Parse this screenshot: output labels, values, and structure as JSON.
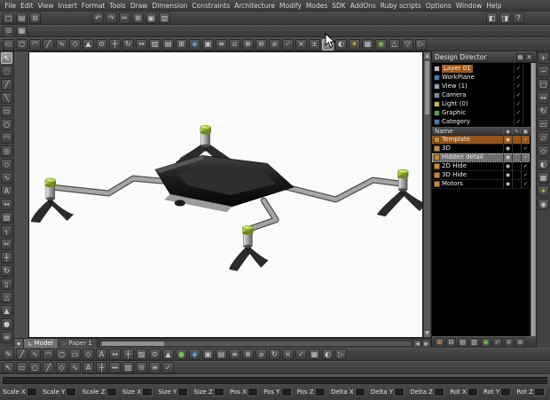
{
  "menu_bar": {
    "items": [
      "File",
      "Edit",
      "View",
      "Insert",
      "Format",
      "Tools",
      "Draw",
      "Dimension",
      "Constraints",
      "Architecture",
      "Modify",
      "Modes",
      "SDK",
      "AddOns",
      "Ruby scripts",
      "Options",
      "Window",
      "Help"
    ]
  },
  "toolbar_row1": {
    "left_icons": [
      {
        "name": "new-file-icon",
        "glyph": "□"
      },
      {
        "name": "open-file-icon",
        "glyph": "▤"
      },
      {
        "name": "save-file-icon",
        "glyph": "⊟"
      }
    ],
    "mid_icons": [
      {
        "name": "undo-icon",
        "glyph": "↶"
      },
      {
        "name": "redo-icon",
        "glyph": "↷"
      },
      {
        "name": "cut-icon",
        "glyph": "✂"
      },
      {
        "name": "copy-icon",
        "glyph": "⊞"
      },
      {
        "name": "paste-icon",
        "glyph": "▣"
      },
      {
        "name": "print-icon",
        "glyph": "▥"
      }
    ],
    "right_icons": [
      {
        "name": "screen-split-icon",
        "glyph": "◧"
      },
      {
        "name": "layout-mode-icon",
        "glyph": "◨"
      },
      {
        "name": "help-icon",
        "glyph": "?"
      }
    ]
  },
  "toolbar_row2": {
    "icons": [
      {
        "name": "snap-toggle-icon",
        "glyph": "⊙"
      },
      {
        "name": "grid-toggle-icon",
        "glyph": "▦"
      }
    ]
  },
  "toolbar_row3": {
    "icons": [
      {
        "name": "rectangle-tool-icon",
        "glyph": "▭"
      },
      {
        "name": "circle-tool-icon",
        "glyph": "○"
      },
      {
        "name": "arc-tool-icon",
        "glyph": "◠"
      },
      {
        "name": "line-tool-icon",
        "glyph": "╱"
      },
      {
        "name": "spline-tool-icon",
        "glyph": "∿"
      },
      {
        "name": "polygon-tool-icon",
        "glyph": "◇"
      },
      {
        "name": "pyramid-tool-icon",
        "glyph": "▲"
      },
      {
        "name": "point-tool-icon",
        "glyph": "⊙"
      },
      {
        "name": "move-tool-icon",
        "glyph": "┼"
      },
      {
        "name": "rotate-tool-icon",
        "glyph": "↻"
      },
      {
        "name": "mirror-tool-icon",
        "glyph": "↔"
      },
      {
        "name": "hatch-tool-icon",
        "glyph": "▨"
      },
      {
        "name": "layers-icon",
        "glyph": "▤"
      },
      {
        "name": "array-tool-icon",
        "glyph": "⊞"
      },
      {
        "name": "solid-tool-icon",
        "glyph": "◆",
        "color": "#5b9bd5"
      },
      {
        "name": "region-tool-icon",
        "glyph": "▣"
      },
      {
        "name": "list-icon",
        "glyph": "≡"
      },
      {
        "name": "home-view-icon",
        "glyph": "⌂"
      },
      {
        "name": "union-tool-icon",
        "glyph": "⊕"
      },
      {
        "name": "subtract-tool-icon",
        "glyph": "⊖"
      },
      {
        "name": "diameter-dim-icon",
        "glyph": "⌀"
      },
      {
        "name": "validate-icon",
        "glyph": "✓",
        "color": "#7ac142"
      },
      {
        "name": "delete-icon",
        "glyph": "×"
      },
      {
        "name": "offset-tool-icon",
        "glyph": "±"
      },
      {
        "name": "select-tool-icon",
        "glyph": "↖",
        "active": true
      },
      {
        "name": "shade-mode-icon",
        "glyph": "◐"
      },
      {
        "name": "light-icon",
        "glyph": "☀",
        "color": "#e8c840"
      },
      {
        "name": "grid-icon",
        "glyph": "▦"
      },
      {
        "name": "render-icon",
        "glyph": "◉",
        "color": "#7ac142"
      },
      {
        "name": "scale-tool-icon",
        "glyph": "△"
      },
      {
        "name": "taper-tool-icon",
        "glyph": "▽"
      },
      {
        "name": "play-icon",
        "glyph": "▷"
      }
    ]
  },
  "left_toolbar": {
    "icons": [
      {
        "name": "select-arrow-icon",
        "glyph": "↖",
        "active": true
      },
      {
        "name": "lasso-select-icon",
        "glyph": "◌"
      },
      {
        "name": "line-tool-icon",
        "glyph": "╱"
      },
      {
        "name": "polyline-tool-icon",
        "glyph": "╲"
      },
      {
        "name": "rectangle-tool-icon",
        "glyph": "▭"
      },
      {
        "name": "circle-tool-icon",
        "glyph": "○"
      },
      {
        "name": "arc-tool-icon",
        "glyph": "◠"
      },
      {
        "name": "ellipse-tool-icon",
        "glyph": "◎"
      },
      {
        "name": "polygon-tool-icon",
        "glyph": "◇"
      },
      {
        "name": "spline-tool-icon",
        "glyph": "∿"
      },
      {
        "name": "text-tool-icon",
        "glyph": "A"
      },
      {
        "name": "dimension-tool-icon",
        "glyph": "↔"
      },
      {
        "name": "hatch-tool-icon",
        "glyph": "▨"
      },
      {
        "name": "fillet-tool-icon",
        "glyph": "┐"
      },
      {
        "name": "trim-tool-icon",
        "glyph": "✂"
      },
      {
        "name": "move-tool-icon",
        "glyph": "┼"
      },
      {
        "name": "rotate-tool-icon",
        "glyph": "↻"
      },
      {
        "name": "mirror-tool-icon",
        "glyph": "▯"
      },
      {
        "name": "scale-tool-icon",
        "glyph": "△"
      },
      {
        "name": "extrude-tool-icon",
        "glyph": "▲"
      },
      {
        "name": "sphere-tool-icon",
        "glyph": "●"
      },
      {
        "name": "tool-options-icon",
        "glyph": "≡"
      }
    ]
  },
  "right_toolbar": {
    "icons": [
      {
        "name": "zoom-in-icon",
        "glyph": "+"
      },
      {
        "name": "zoom-out-icon",
        "glyph": "−"
      },
      {
        "name": "zoom-fit-icon",
        "glyph": "□"
      },
      {
        "name": "pan-icon",
        "glyph": "↔"
      },
      {
        "name": "orbit-icon",
        "glyph": "↻"
      },
      {
        "name": "top-view-icon",
        "glyph": "▭"
      },
      {
        "name": "front-view-icon",
        "glyph": "▱"
      },
      {
        "name": "iso-view-icon",
        "glyph": "◇"
      },
      {
        "name": "shade-mode-icon",
        "glyph": "◐"
      },
      {
        "name": "wireframe-mode-icon",
        "glyph": "▦"
      },
      {
        "name": "sun-light-icon",
        "glyph": "☀",
        "color": "#e8c840"
      },
      {
        "name": "camera-view-icon",
        "glyph": "◉"
      }
    ]
  },
  "viewport": {
    "model": "quadcopter-drone",
    "background": "#fbfbfb",
    "rotor_cap_color": "#b8d44e",
    "body_color": "#1c1c1c"
  },
  "canvas_tabs": {
    "corner_glyph": "◆",
    "tabs": [
      {
        "label": "Model",
        "glyph": "◣",
        "active": true
      },
      {
        "label": "Paper 1",
        "glyph": "▷",
        "active": false
      }
    ],
    "left_arrow": "◀",
    "right_arrow": "▶",
    "up_arrow": "▲",
    "down_arrow": "▼"
  },
  "design_director": {
    "title": "Design Director",
    "header_icons": [
      {
        "name": "panel-menu-icon",
        "glyph": "▤"
      },
      {
        "name": "panel-close-icon",
        "glyph": "×"
      }
    ],
    "tree_items": [
      {
        "label": "Layer 01",
        "icon_color": "#b8b8b8",
        "check": "✓",
        "selected": true
      },
      {
        "label": "WorkPlane",
        "icon_color": "#4a7ab5",
        "check": "✓"
      },
      {
        "label": "View (1)",
        "icon_color": "#8aa5c0",
        "check": "✓"
      },
      {
        "label": "Camera",
        "icon_color": "#7a8aa0",
        "check": "✓"
      },
      {
        "label": "Light (0)",
        "icon_color": "#c8b05a",
        "check": "✓"
      },
      {
        "label": "Graphic",
        "icon_color": "#5a9a5a",
        "check": "✓"
      },
      {
        "label": "Category",
        "icon_color": "#4a7ab5",
        "check": "✓"
      }
    ],
    "table": {
      "name_header": "Name",
      "col_icons": [
        {
          "name": "visible-column-icon",
          "glyph": "◉"
        },
        {
          "name": "edit-column-icon",
          "glyph": "✎"
        },
        {
          "name": "lock-column-icon",
          "glyph": "▣"
        }
      ],
      "rows": [
        {
          "name": "Template",
          "c1": "◉",
          "c2": "",
          "c3": "✓",
          "orange": true
        },
        {
          "name": "3D",
          "c1": "◉",
          "c2": "",
          "c3": "✓"
        },
        {
          "name": "Hidden detail",
          "c1": "◉",
          "c2": "",
          "c3": "✓",
          "selected": true
        },
        {
          "name": "2D Hide",
          "c1": "◉",
          "c2": "",
          "c3": "✓"
        },
        {
          "name": "3D Hide",
          "c1": "◉",
          "c2": "",
          "c3": "✓"
        },
        {
          "name": "Motors",
          "c1": "◉",
          "c2": "",
          "c3": "✓"
        }
      ]
    },
    "bottom_icons": [
      {
        "name": "new-layer-icon",
        "glyph": "⊞",
        "color": "#e8a33d"
      },
      {
        "name": "delete-layer-icon",
        "glyph": "⊟"
      },
      {
        "name": "layer-properties-icon",
        "glyph": "▤"
      },
      {
        "name": "sort-layers-icon",
        "glyph": "▥"
      },
      {
        "name": "toggle-visibility-icon",
        "glyph": "◉",
        "color": "#7ac142"
      },
      {
        "name": "check-all-icon",
        "glyph": "✓"
      },
      {
        "name": "clear-all-icon",
        "glyph": "×"
      },
      {
        "name": "panel-options-icon",
        "glyph": "≡"
      }
    ]
  },
  "bottom_toolbar1": {
    "icons": [
      {
        "name": "pencil-tool-icon",
        "glyph": "✎"
      },
      {
        "name": "line-tool-icon",
        "glyph": "╱"
      },
      {
        "name": "curve-tool-icon",
        "glyph": "∿"
      },
      {
        "name": "arc-tool-icon",
        "glyph": "◠"
      },
      {
        "name": "circle-tool-icon",
        "glyph": "○"
      },
      {
        "name": "rectangle-tool-icon",
        "glyph": "▭"
      },
      {
        "name": "polygon-tool-icon",
        "glyph": "◇"
      },
      {
        "name": "text-tool-icon",
        "glyph": "A"
      },
      {
        "name": "dimension-tool-icon",
        "glyph": "↔"
      },
      {
        "name": "move-tool-icon",
        "glyph": "┼"
      },
      {
        "name": "hatch-tool-icon",
        "glyph": "▨"
      },
      {
        "name": "snap-point-icon",
        "glyph": "⊙"
      },
      {
        "name": "extrude-tool-icon",
        "glyph": "▲"
      },
      {
        "name": "sphere-tool-icon",
        "glyph": "●",
        "color": "#7ac142"
      },
      {
        "name": "cone-tool-icon",
        "glyph": "◆",
        "color": "#5b9bd5"
      },
      {
        "name": "slab-tool-icon",
        "glyph": "▣"
      },
      {
        "name": "layers-icon",
        "glyph": "▤"
      },
      {
        "name": "properties-icon",
        "glyph": "≡"
      },
      {
        "name": "add-icon",
        "glyph": "⊕"
      },
      {
        "name": "diameter-dim-icon",
        "glyph": "⌀"
      },
      {
        "name": "rotate-tool-icon",
        "glyph": "↻"
      },
      {
        "name": "erase-tool-icon",
        "glyph": "×"
      },
      {
        "name": "confirm-icon",
        "glyph": "✓"
      },
      {
        "name": "grid-icon",
        "glyph": "▦"
      },
      {
        "name": "shade-mode-icon",
        "glyph": "◐"
      },
      {
        "name": "run-icon",
        "glyph": "▷"
      }
    ]
  },
  "bottom_toolbar2": {
    "icons": [
      {
        "name": "select-tool-icon",
        "glyph": "↖"
      },
      {
        "name": "rectangle-tool-icon",
        "glyph": "▭"
      },
      {
        "name": "circle-tool-icon",
        "glyph": "○"
      },
      {
        "name": "line-tool-icon",
        "glyph": "╱"
      },
      {
        "name": "polygon-tool-icon",
        "glyph": "◇"
      },
      {
        "name": "spline-tool-icon",
        "glyph": "∿"
      },
      {
        "name": "text-tool-icon",
        "glyph": "A"
      },
      {
        "name": "move-tool-icon",
        "glyph": "┼"
      },
      {
        "name": "mirror-tool-icon",
        "glyph": "↔"
      },
      {
        "name": "hatch-tool-icon",
        "glyph": "▨"
      },
      {
        "name": "point-tool-icon",
        "glyph": "⊙"
      },
      {
        "name": "list-icon",
        "glyph": "≡"
      },
      {
        "name": "apply-icon",
        "glyph": "✓"
      }
    ]
  },
  "status_bar": {
    "fields": [
      {
        "label": "Scale X",
        "value": ""
      },
      {
        "label": "Scale Y",
        "value": ""
      },
      {
        "label": "Scale Z",
        "value": ""
      },
      {
        "label": "Size X",
        "value": ""
      },
      {
        "label": "Size Y",
        "value": ""
      },
      {
        "label": "Size Z",
        "value": ""
      },
      {
        "label": "Pos X",
        "value": ""
      },
      {
        "label": "Pos Y",
        "value": ""
      },
      {
        "label": "Pos Z",
        "value": ""
      },
      {
        "label": "Delta X",
        "value": ""
      },
      {
        "label": "Delta Y",
        "value": ""
      },
      {
        "label": "Delta Z",
        "value": ""
      },
      {
        "label": "Rot X",
        "value": ""
      },
      {
        "label": "Rot Y",
        "value": ""
      },
      {
        "label": "Rot Z",
        "value": ""
      }
    ]
  }
}
